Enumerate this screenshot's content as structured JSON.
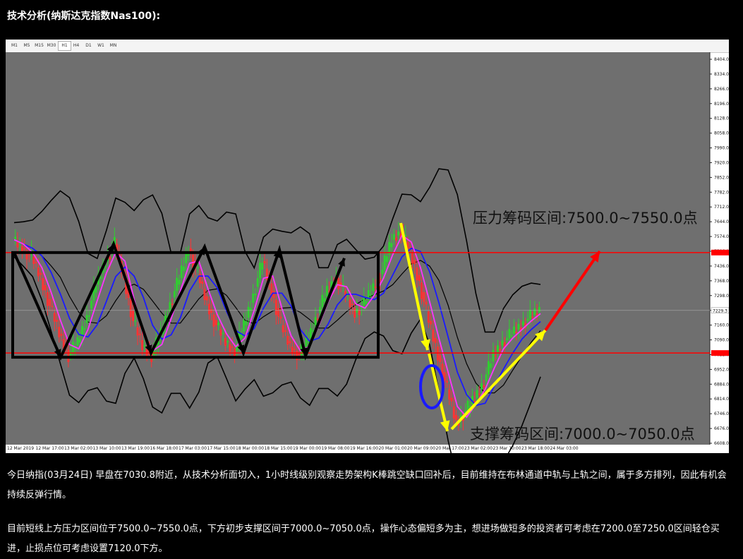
{
  "heading": "技术分析(纳斯达克指数Nas100):",
  "timeframes": [
    "M1",
    "M5",
    "M15",
    "M30",
    "H1",
    "H4",
    "D1",
    "W1",
    "MN"
  ],
  "active_timeframe": "H1",
  "colors": {
    "plot_bg": "#6f6f6f",
    "candle_up": "#2fd02f",
    "candle_down": "#ff3333",
    "bollinger": "#000000",
    "ma_blue": "#1a1aff",
    "ma_magenta": "#ff33ff",
    "level_line": "#ff0000",
    "arrow_yellow": "#ffff00",
    "arrow_red": "#ff0000",
    "circle": "#1a1aff"
  },
  "chart_data": {
    "type": "candlestick",
    "symbol": "Nas100",
    "timeframe": "H1",
    "ylim": [
      6608.0,
      8434.0
    ],
    "y_ticks": [
      "8404.0",
      "8334.0",
      "8266.0",
      "8196.0",
      "8128.0",
      "8058.0",
      "7990.0",
      "7920.0",
      "7852.0",
      "7782.0",
      "7712.0",
      "7644.0",
      "7574.0",
      "7506.0",
      "7436.0",
      "7368.0",
      "7298.0",
      "7229.3",
      "7160.0",
      "7090.0",
      "7022.0",
      "6952.0",
      "6884.0",
      "6814.0",
      "6746.0",
      "6676.0",
      "6608.0"
    ],
    "x_ticks": [
      "12 Mar 2019",
      "12 Mar 17:00",
      "13 Mar 02:00",
      "13 Mar 10:00",
      "13 Mar 19:00",
      "16 Mar 18:00",
      "17 Mar 03:00",
      "17 Mar 15:00",
      "18 Mar 00:00",
      "18 Mar 15:00",
      "19 Mar 00:00",
      "19 Mar 08:00",
      "19 Mar 16:00",
      "20 Mar 01:00",
      "20 Mar 09:00",
      "20 Mar 17:00",
      "23 Mar 02:00",
      "23 Mar 10:00",
      "23 Mar 18:00",
      "24 Mar 03:00"
    ],
    "current_price": "7229.3",
    "resistance_level": 7500,
    "support_level": 7030,
    "annotations": {
      "resistance": "压力筹码区间:7500.0~7550.0点",
      "support": "支撑筹码区间:7000.0~7050.0点"
    },
    "close_path": [
      7560,
      7520,
      7480,
      7380,
      7250,
      7120,
      7020,
      7080,
      7200,
      7350,
      7460,
      7540,
      7380,
      7180,
      7060,
      7020,
      7120,
      7260,
      7380,
      7520,
      7400,
      7260,
      7160,
      7080,
      7040,
      7160,
      7300,
      7460,
      7320,
      7160,
      7060,
      7020,
      7100,
      7220,
      7320,
      7380,
      7300,
      7220,
      7260,
      7340,
      7420,
      7560,
      7600,
      7500,
      7360,
      7180,
      7020,
      6860,
      6700,
      6760,
      6820,
      6900,
      7020,
      7080,
      7120,
      7160,
      7200,
      7229
    ]
  },
  "paragraph1": "今日纳指(03月24日) 早盘在7030.8附近，从技术分析面切入，1小时线级别观察走势架构K棒跳空缺口回补后，目前维持在布林通道中轨与上轨之间，属于多方排列，因此有机会持续反弹行情。",
  "paragraph2": "目前短线上方压力区间位于7500.0~7550.0点，下方初步支撑区间于7000.0~7050.0点，操作心态偏短多为主，想进场做短多的投资者可考虑在7200.0至7250.0区间轻仓买进，止损点位可考虑设置7120.0下方。"
}
